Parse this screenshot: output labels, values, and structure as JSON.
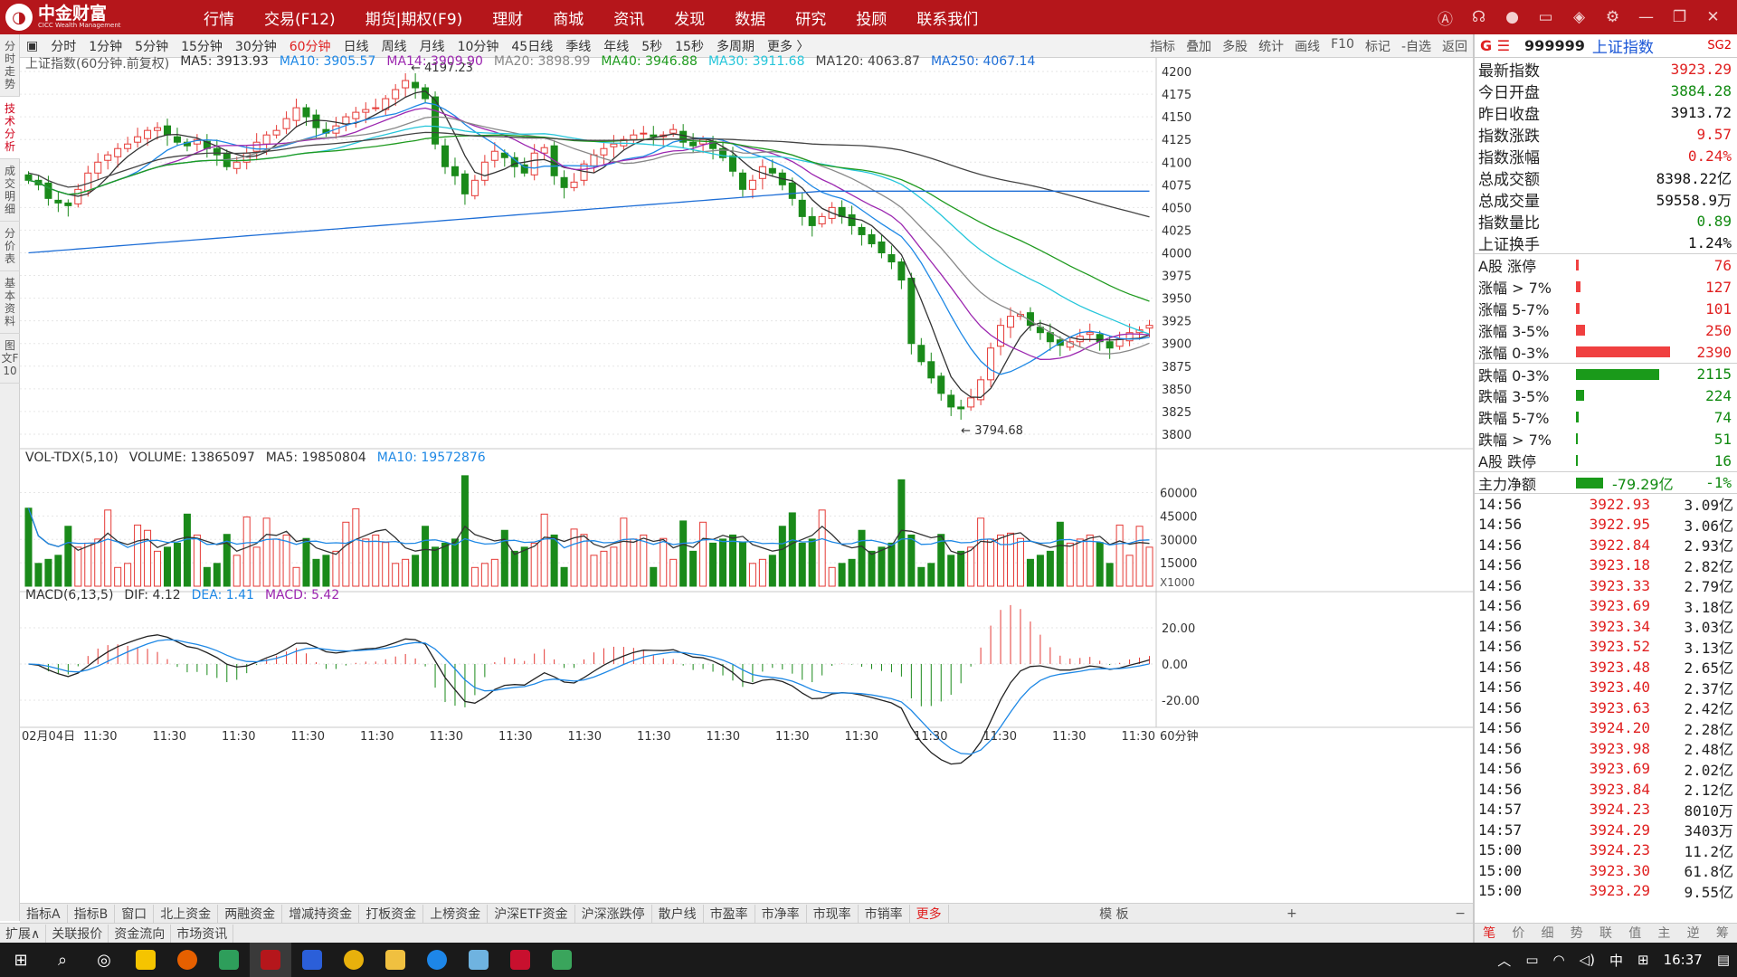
{
  "app": {
    "logo_cn": "中金财富",
    "logo_en": "CICC Wealth Management",
    "menu": [
      "行情",
      "交易(F12)",
      "期货|期权(F9)",
      "理财",
      "商城",
      "资讯",
      "发现",
      "数据",
      "研究",
      "投顾",
      "联系我们"
    ]
  },
  "left_tabs": [
    "分时走势",
    "技术分析",
    "成交明细",
    "分价表",
    "基本资料",
    "图文F10"
  ],
  "periods": [
    "分时",
    "1分钟",
    "5分钟",
    "15分钟",
    "30分钟",
    "60分钟",
    "日线",
    "周线",
    "月线",
    "10分钟",
    "45日线",
    "季线",
    "年线",
    "5秒",
    "15秒",
    "多周期",
    "更多 〉"
  ],
  "tools": [
    "指标",
    "叠加",
    "多股",
    "统计",
    "画线",
    "F10",
    "标记",
    "-自选",
    "返回"
  ],
  "main_legend": {
    "title": "上证指数(60分钟.前复权)",
    "ma5": "MA5: 3913.93",
    "ma10": "MA10: 3905.57",
    "ma14": "MA14: 3909.90",
    "ma20": "MA20: 3898.99",
    "ma40": "MA40: 3946.88",
    "ma30": "MA30: 3911.68",
    "ma120": "MA120: 4063.87",
    "ma250": "MA250: 4067.14"
  },
  "main_annotations": {
    "high": "4197.23",
    "low": "3794.68"
  },
  "vol_legend": {
    "title": "VOL-TDX(5,10)",
    "volume": "VOLUME: 13865097",
    "ma5": "MA5: 19850804",
    "ma10": "MA10: 19572876"
  },
  "vol_unit": "X1000",
  "macd_legend": {
    "title": "MACD(6,13,5)",
    "dif": "DIF: 4.12",
    "dea": "DEA: 1.41",
    "macd": "MACD: 5.42"
  },
  "x_axis": {
    "start": "02月04日",
    "ticks": [
      "11:30",
      "11:30",
      "11:30",
      "11:30",
      "11:30",
      "11:30",
      "11:30",
      "11:30",
      "11:30",
      "11:30",
      "11:30",
      "11:30",
      "11:30",
      "11:30",
      "11:30",
      "11:30"
    ],
    "period": "60分钟"
  },
  "bottom_tabs": [
    "指标A",
    "指标B",
    "窗口",
    "北上资金",
    "两融资金",
    "增减持资金",
    "打板资金",
    "上榜资金",
    "沪深ETF资金",
    "沪深涨跌停",
    "散户线",
    "市盈率",
    "市净率",
    "市现率",
    "市销率",
    "更多"
  ],
  "bottom_tabs2": [
    "扩展∧",
    "关联报价",
    "资金流向",
    "市场资讯"
  ],
  "template_mode": "模 板",
  "chart_data": {
    "type": "candlestick",
    "main_yticks": [
      4200,
      4175,
      4150,
      4125,
      4100,
      4075,
      4050,
      4025,
      4000,
      3975,
      3950,
      3925,
      3900,
      3875,
      3850,
      3825,
      3800
    ],
    "main_ylim": [
      3790,
      4205
    ],
    "vol_yticks": [
      60000,
      45000,
      30000,
      15000
    ],
    "vol_ylim": [
      0,
      80000
    ],
    "macd_yticks": [
      20.0,
      0.0,
      -20.0
    ],
    "macd_ylim": [
      -32,
      36
    ],
    "closes": [
      4080,
      4075,
      4060,
      4055,
      4052,
      4070,
      4088,
      4100,
      4108,
      4115,
      4120,
      4128,
      4135,
      4138,
      4130,
      4122,
      4118,
      4125,
      4115,
      4108,
      4095,
      4100,
      4110,
      4122,
      4130,
      4135,
      4148,
      4160,
      4150,
      4138,
      4132,
      4140,
      4150,
      4155,
      4158,
      4160,
      4170,
      4180,
      4190,
      4182,
      4170,
      4120,
      4095,
      4085,
      4065,
      4080,
      4100,
      4112,
      4105,
      4095,
      4088,
      4110,
      4116,
      4085,
      4072,
      4078,
      4098,
      4108,
      4115,
      4120,
      4125,
      4130,
      4132,
      4128,
      4130,
      4136,
      4122,
      4118,
      4125,
      4115,
      4105,
      4090,
      4070,
      4080,
      4095,
      4088,
      4075,
      4060,
      4040,
      4030,
      4040,
      4050,
      4040,
      4030,
      4020,
      4010,
      4000,
      3990,
      3970,
      3900,
      3880,
      3862,
      3845,
      3830,
      3828,
      3840,
      3860,
      3895,
      3920,
      3930,
      3932,
      3920,
      3912,
      3902,
      3898,
      3902,
      3908,
      3912,
      3902,
      3895,
      3905,
      3912,
      3915,
      3920
    ]
  },
  "quote": {
    "g": "G ☰",
    "code": "999999",
    "name": "上证指数",
    "sg": "SG2",
    "rows": [
      {
        "label": "最新指数",
        "value": "3923.29",
        "color": "red"
      },
      {
        "label": "今日开盘",
        "value": "3884.28",
        "color": "green"
      },
      {
        "label": "昨日收盘",
        "value": "3913.72",
        "color": "blk"
      },
      {
        "label": "指数涨跌",
        "value": "9.57",
        "color": "red"
      },
      {
        "label": "指数涨幅",
        "value": "0.24%",
        "color": "red"
      },
      {
        "label": "总成交额",
        "value": "8398.22亿",
        "color": "blk"
      },
      {
        "label": "总成交量",
        "value": "59558.9万",
        "color": "blk"
      },
      {
        "label": "指数量比",
        "value": "0.89",
        "color": "green"
      },
      {
        "label": "上证换手",
        "value": "1.24%",
        "color": "blk"
      }
    ],
    "breadth": [
      {
        "label": "A股 涨停",
        "value": "76",
        "color": "red",
        "frac": 0.03
      },
      {
        "label": "涨幅 > 7%",
        "value": "127",
        "color": "red",
        "frac": 0.05
      },
      {
        "label": "涨幅 5-7%",
        "value": "101",
        "color": "red",
        "frac": 0.04
      },
      {
        "label": "涨幅 3-5%",
        "value": "250",
        "color": "red",
        "frac": 0.1
      },
      {
        "label": "涨幅 0-3%",
        "value": "2390",
        "color": "red",
        "frac": 1.0
      },
      {
        "label": "跌幅 0-3%",
        "value": "2115",
        "color": "green",
        "frac": 0.885
      },
      {
        "label": "跌幅 3-5%",
        "value": "224",
        "color": "green",
        "frac": 0.09
      },
      {
        "label": "跌幅 5-7%",
        "value": "74",
        "color": "green",
        "frac": 0.03
      },
      {
        "label": "跌幅 > 7%",
        "value": "51",
        "color": "green",
        "frac": 0.02
      },
      {
        "label": "A股 跌停",
        "value": "16",
        "color": "green",
        "frac": 0.01
      }
    ],
    "net_flow": {
      "label": "主力净额",
      "value": "-79.29亿",
      "pct": "-1%"
    },
    "ticks": [
      {
        "t": "14:56",
        "p": "3922.93",
        "a": "3.09亿"
      },
      {
        "t": "14:56",
        "p": "3922.95",
        "a": "3.06亿"
      },
      {
        "t": "14:56",
        "p": "3922.84",
        "a": "2.93亿"
      },
      {
        "t": "14:56",
        "p": "3923.18",
        "a": "2.82亿"
      },
      {
        "t": "14:56",
        "p": "3923.33",
        "a": "2.79亿"
      },
      {
        "t": "14:56",
        "p": "3923.69",
        "a": "3.18亿"
      },
      {
        "t": "14:56",
        "p": "3923.34",
        "a": "3.03亿"
      },
      {
        "t": "14:56",
        "p": "3923.52",
        "a": "3.13亿"
      },
      {
        "t": "14:56",
        "p": "3923.48",
        "a": "2.65亿"
      },
      {
        "t": "14:56",
        "p": "3923.40",
        "a": "2.37亿"
      },
      {
        "t": "14:56",
        "p": "3923.63",
        "a": "2.42亿"
      },
      {
        "t": "14:56",
        "p": "3924.20",
        "a": "2.28亿"
      },
      {
        "t": "14:56",
        "p": "3923.98",
        "a": "2.48亿"
      },
      {
        "t": "14:56",
        "p": "3923.69",
        "a": "2.02亿"
      },
      {
        "t": "14:56",
        "p": "3923.84",
        "a": "2.12亿"
      },
      {
        "t": "14:57",
        "p": "3924.23",
        "a": "8010万"
      },
      {
        "t": "14:57",
        "p": "3924.29",
        "a": "3403万"
      },
      {
        "t": "15:00",
        "p": "3924.23",
        "a": "11.2亿"
      },
      {
        "t": "15:00",
        "p": "3923.30",
        "a": "61.8亿"
      },
      {
        "t": "15:00",
        "p": "3923.29",
        "a": "9.55亿"
      }
    ],
    "tabs": [
      "笔",
      "价",
      "细",
      "势",
      "联",
      "值",
      "主",
      "逆",
      "筹"
    ]
  },
  "taskbar": {
    "time": "16:37",
    "ime": "中"
  }
}
